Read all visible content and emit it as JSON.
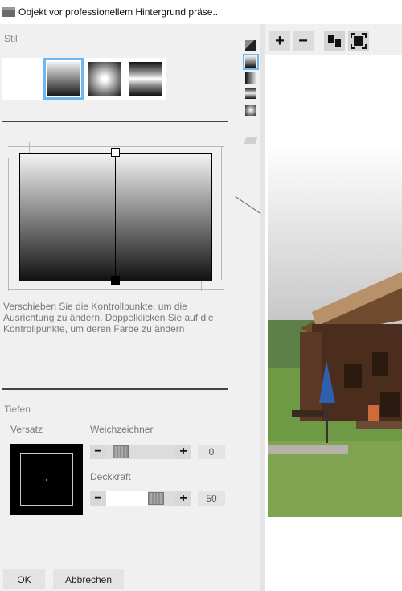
{
  "window": {
    "title": "Objekt vor professionellem Hintergrund präse.."
  },
  "style": {
    "label": "Stil",
    "options": [
      {
        "name": "plain",
        "selected": false
      },
      {
        "name": "linear",
        "selected": true
      },
      {
        "name": "radial",
        "selected": false
      },
      {
        "name": "band",
        "selected": false
      }
    ]
  },
  "editor": {
    "hint": "Verschieben Sie die Kontrollpunkte, um die Ausrichtung zu ändern. Doppelklicken Sie auf die Kontrollpunkte, um deren Farbe zu ändern"
  },
  "depth": {
    "label": "Tiefen",
    "offset_label": "Versatz",
    "blur": {
      "label": "Weichzeichner",
      "value": "0"
    },
    "opacity": {
      "label": "Deckkraft",
      "value": "50"
    }
  },
  "buttons": {
    "ok": "OK",
    "cancel": "Abbrechen"
  },
  "zoom": {
    "in": "+",
    "out": "−"
  },
  "stepper": {
    "minus": "−",
    "plus": "+"
  },
  "colors": {
    "accent": "#6fb7ef"
  }
}
